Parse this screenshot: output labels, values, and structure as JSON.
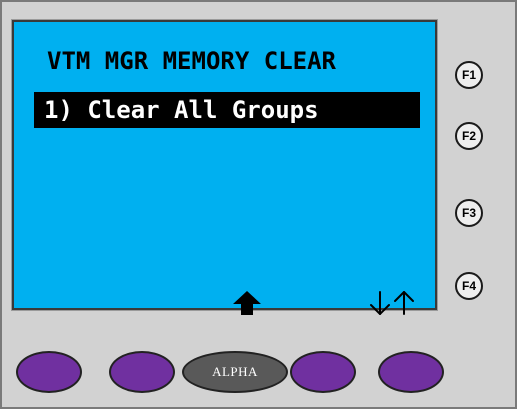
{
  "screen": {
    "title": "VTM MGR MEMORY CLEAR",
    "menu_items": [
      {
        "label": "1) Clear All Groups",
        "selected": true
      }
    ],
    "background_color": "#00b0f0",
    "highlight_color": "#000000",
    "nav_icons": [
      "home-up-arrow-icon",
      "scroll-down-up-arrows-icon"
    ]
  },
  "function_keys": [
    {
      "label": "F1"
    },
    {
      "label": "F2"
    },
    {
      "label": "F3"
    },
    {
      "label": "F4"
    }
  ],
  "softkeys": [
    {
      "label": "",
      "color": "#7030a0"
    },
    {
      "label": "",
      "color": "#7030a0"
    },
    {
      "label": "ALPHA",
      "color": "#595959"
    },
    {
      "label": "",
      "color": "#7030a0"
    },
    {
      "label": "",
      "color": "#7030a0"
    }
  ],
  "device_bezel_color": "#d2d2d2"
}
